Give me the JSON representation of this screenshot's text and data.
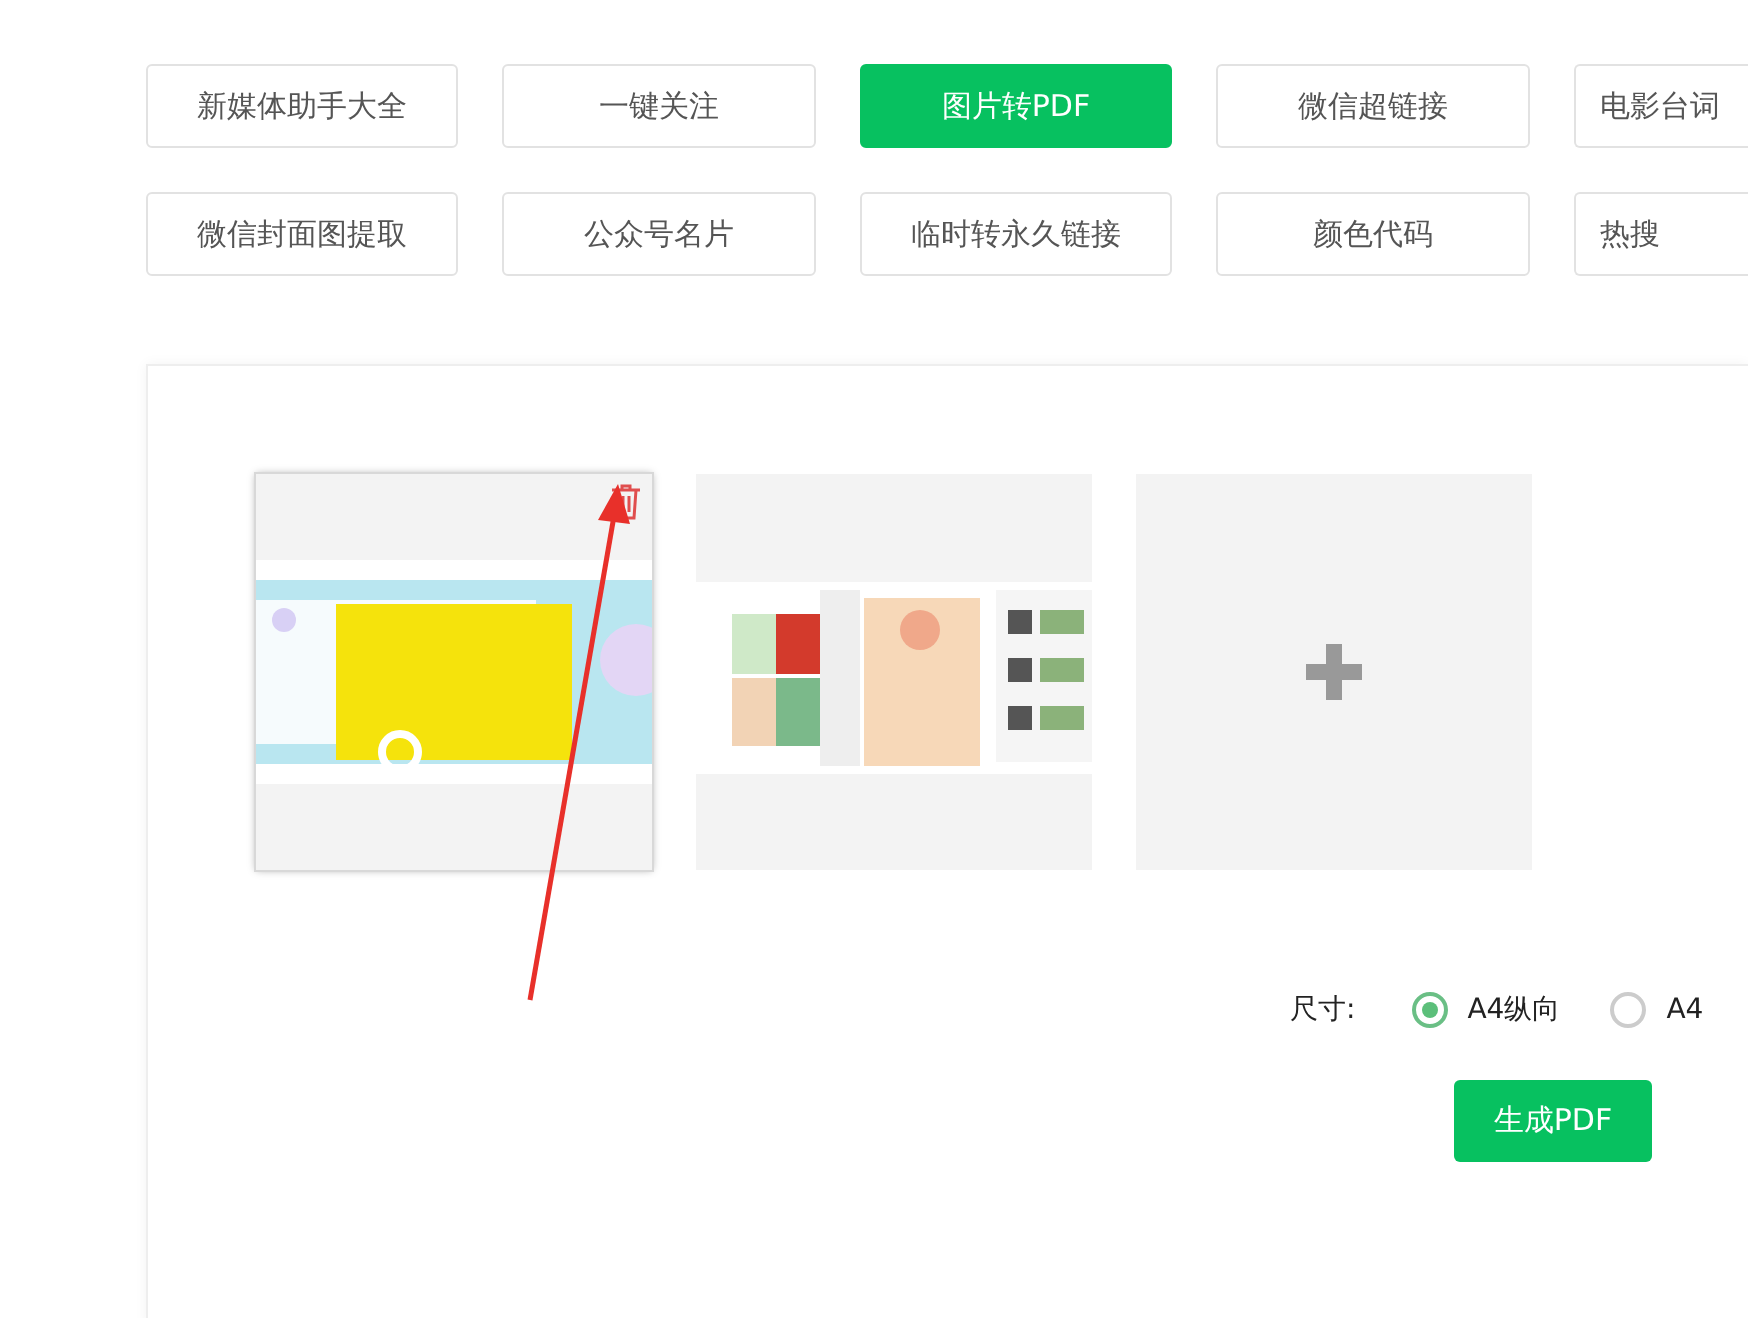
{
  "tools": [
    {
      "label": "新媒体助手大全",
      "selected": false
    },
    {
      "label": "一键关注",
      "selected": false
    },
    {
      "label": "图片转PDF",
      "selected": true
    },
    {
      "label": "微信超链接",
      "selected": false
    },
    {
      "label": "电影台词",
      "selected": false
    },
    {
      "label": "微信封面图提取",
      "selected": false
    },
    {
      "label": "公众号名片",
      "selected": false
    },
    {
      "label": "临时转永久链接",
      "selected": false
    },
    {
      "label": "颜色代码",
      "selected": false
    },
    {
      "label": "热搜",
      "selected": false
    }
  ],
  "images": [
    {
      "kind": "banner",
      "hovered": true
    },
    {
      "kind": "screenshot",
      "hovered": false
    },
    {
      "kind": "add"
    }
  ],
  "size": {
    "label": "尺寸:",
    "options": [
      {
        "label": "A4纵向",
        "selected": true
      },
      {
        "label": "A4",
        "selected": false
      }
    ]
  },
  "generate_button": "生成PDF",
  "annotation": {
    "kind": "arrow"
  }
}
